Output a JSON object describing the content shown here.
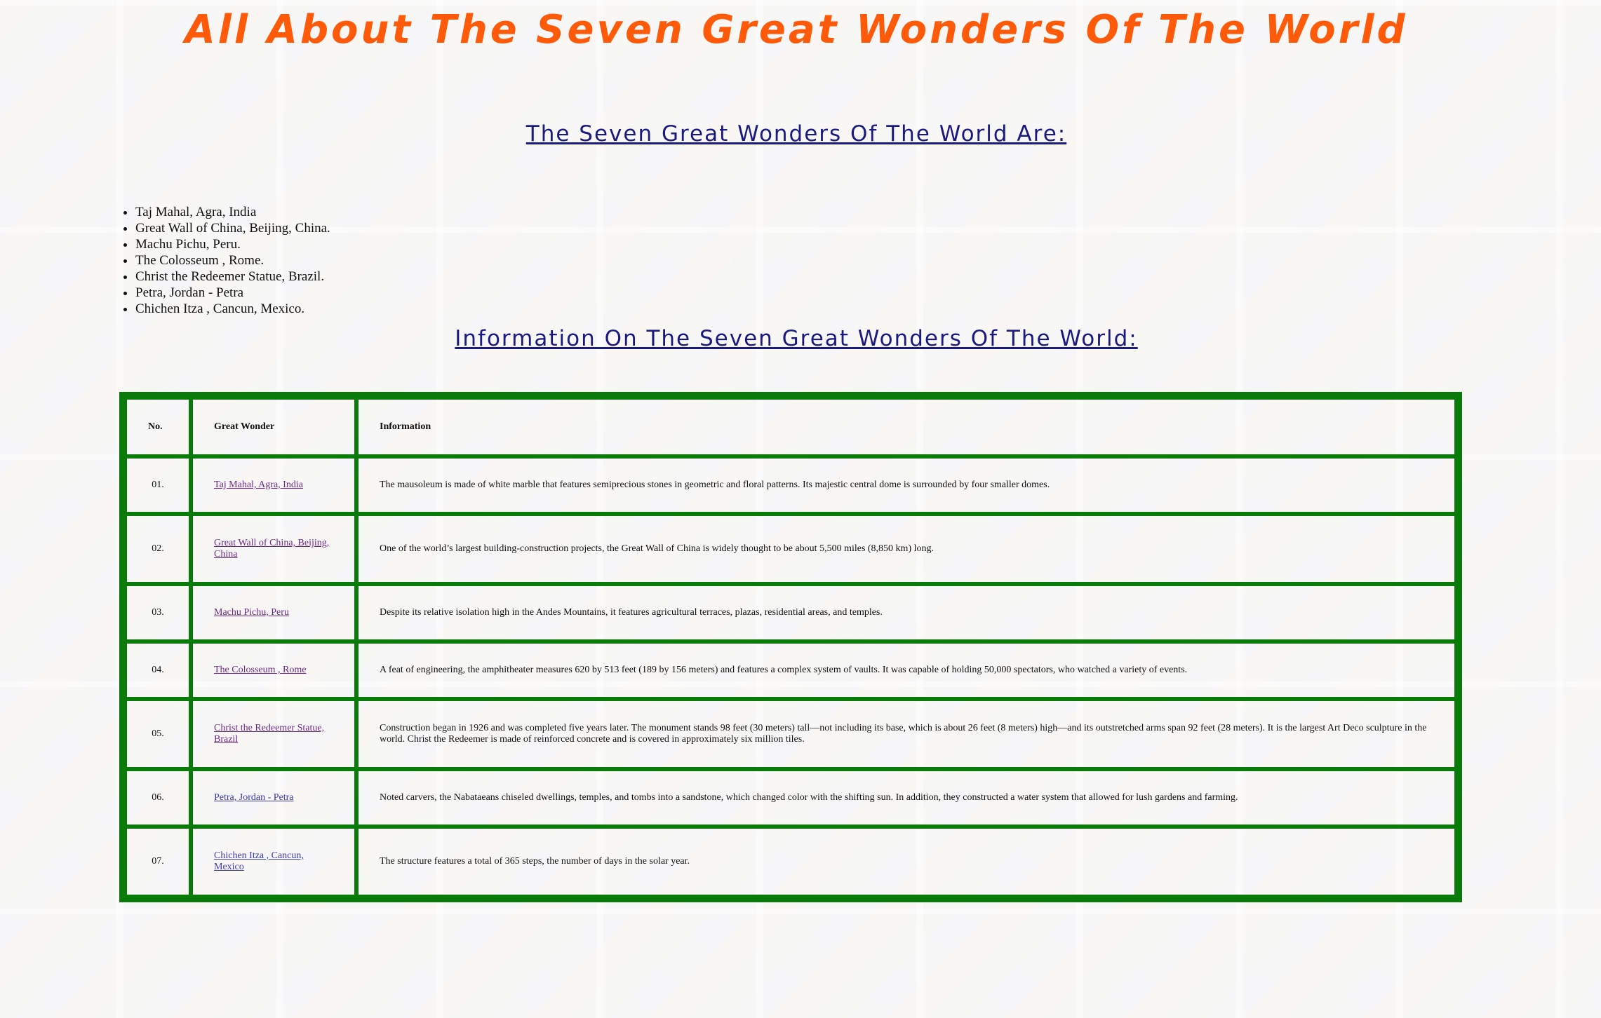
{
  "page": {
    "title": "All About The Seven Great Wonders Of The World"
  },
  "section1": {
    "heading": "The Seven Great Wonders Of The World Are:",
    "items": [
      "Taj Mahal, Agra, India",
      "Great Wall of China, Beijing, China.",
      "Machu Pichu, Peru.",
      "The Colosseum , Rome.",
      "Christ the Redeemer Statue, Brazil.",
      "Petra, Jordan - Petra",
      "Chichen Itza , Cancun, Mexico."
    ]
  },
  "section2": {
    "heading": "Information On The Seven Great Wonders Of The World:"
  },
  "table": {
    "headers": [
      "No.",
      "Great Wonder",
      "Information"
    ],
    "rows": [
      {
        "no": "01.",
        "wonder": "Taj Mahal, Agra, India",
        "info": "The mausoleum is made of white marble that features semiprecious stones in geometric and floral patterns. Its majestic central dome is surrounded by four smaller domes."
      },
      {
        "no": "02.",
        "wonder": "Great Wall of China, Beijing, China",
        "info": "One of the world’s largest building-construction projects, the Great Wall of China is widely thought to be about 5,500 miles (8,850 km) long."
      },
      {
        "no": "03.",
        "wonder": "Machu Pichu, Peru",
        "info": "Despite its relative isolation high in the Andes Mountains, it features agricultural terraces, plazas, residential areas, and temples."
      },
      {
        "no": "04.",
        "wonder": "The Colosseum , Rome",
        "info": "A feat of engineering, the amphitheater measures 620 by 513 feet (189 by 156 meters) and features a complex system of vaults. It was capable of holding 50,000 spectators, who watched a variety of events."
      },
      {
        "no": "05.",
        "wonder": "Christ the Redeemer Statue, Brazil",
        "info": "Construction began in 1926 and was completed five years later. The monument stands 98 feet (30 meters) tall—not including its base, which is about 26 feet (8 meters) high—and its outstretched arms span 92 feet (28 meters). It is the largest Art Deco sculpture in the world. Christ the Redeemer is made of reinforced concrete and is covered in approximately six million tiles."
      },
      {
        "no": "06.",
        "wonder": "Petra, Jordan - Petra",
        "info": "Noted carvers, the Nabataeans chiseled dwellings, temples, and tombs into a sandstone, which changed color with the shifting sun. In addition, they constructed a water system that allowed for lush gardens and farming."
      },
      {
        "no": "07.",
        "wonder": "Chichen Itza , Cancun, Mexico",
        "info": "The structure features a total of 365 steps, the number of days in the solar year."
      }
    ]
  },
  "colors": {
    "title": "#ff5a0a",
    "heading": "#1a1a80",
    "table_border": "#0a7a0a"
  }
}
